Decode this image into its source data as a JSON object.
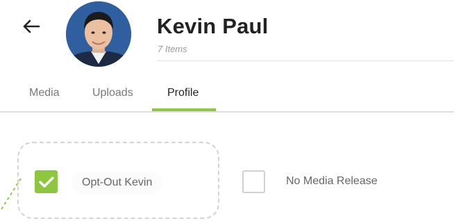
{
  "header": {
    "name": "Kevin Paul",
    "item_count": "7 Items",
    "back_icon": "arrow-left-icon"
  },
  "tabs": [
    {
      "label": "Media",
      "active": false
    },
    {
      "label": "Uploads",
      "active": false
    },
    {
      "label": "Profile",
      "active": true
    }
  ],
  "options": [
    {
      "label": "Opt-Out Kevin",
      "checked": true
    },
    {
      "label": "No Media Release",
      "checked": false
    }
  ],
  "colors": {
    "accent": "#8dc63f",
    "text": "#222222",
    "muted": "#777777"
  }
}
